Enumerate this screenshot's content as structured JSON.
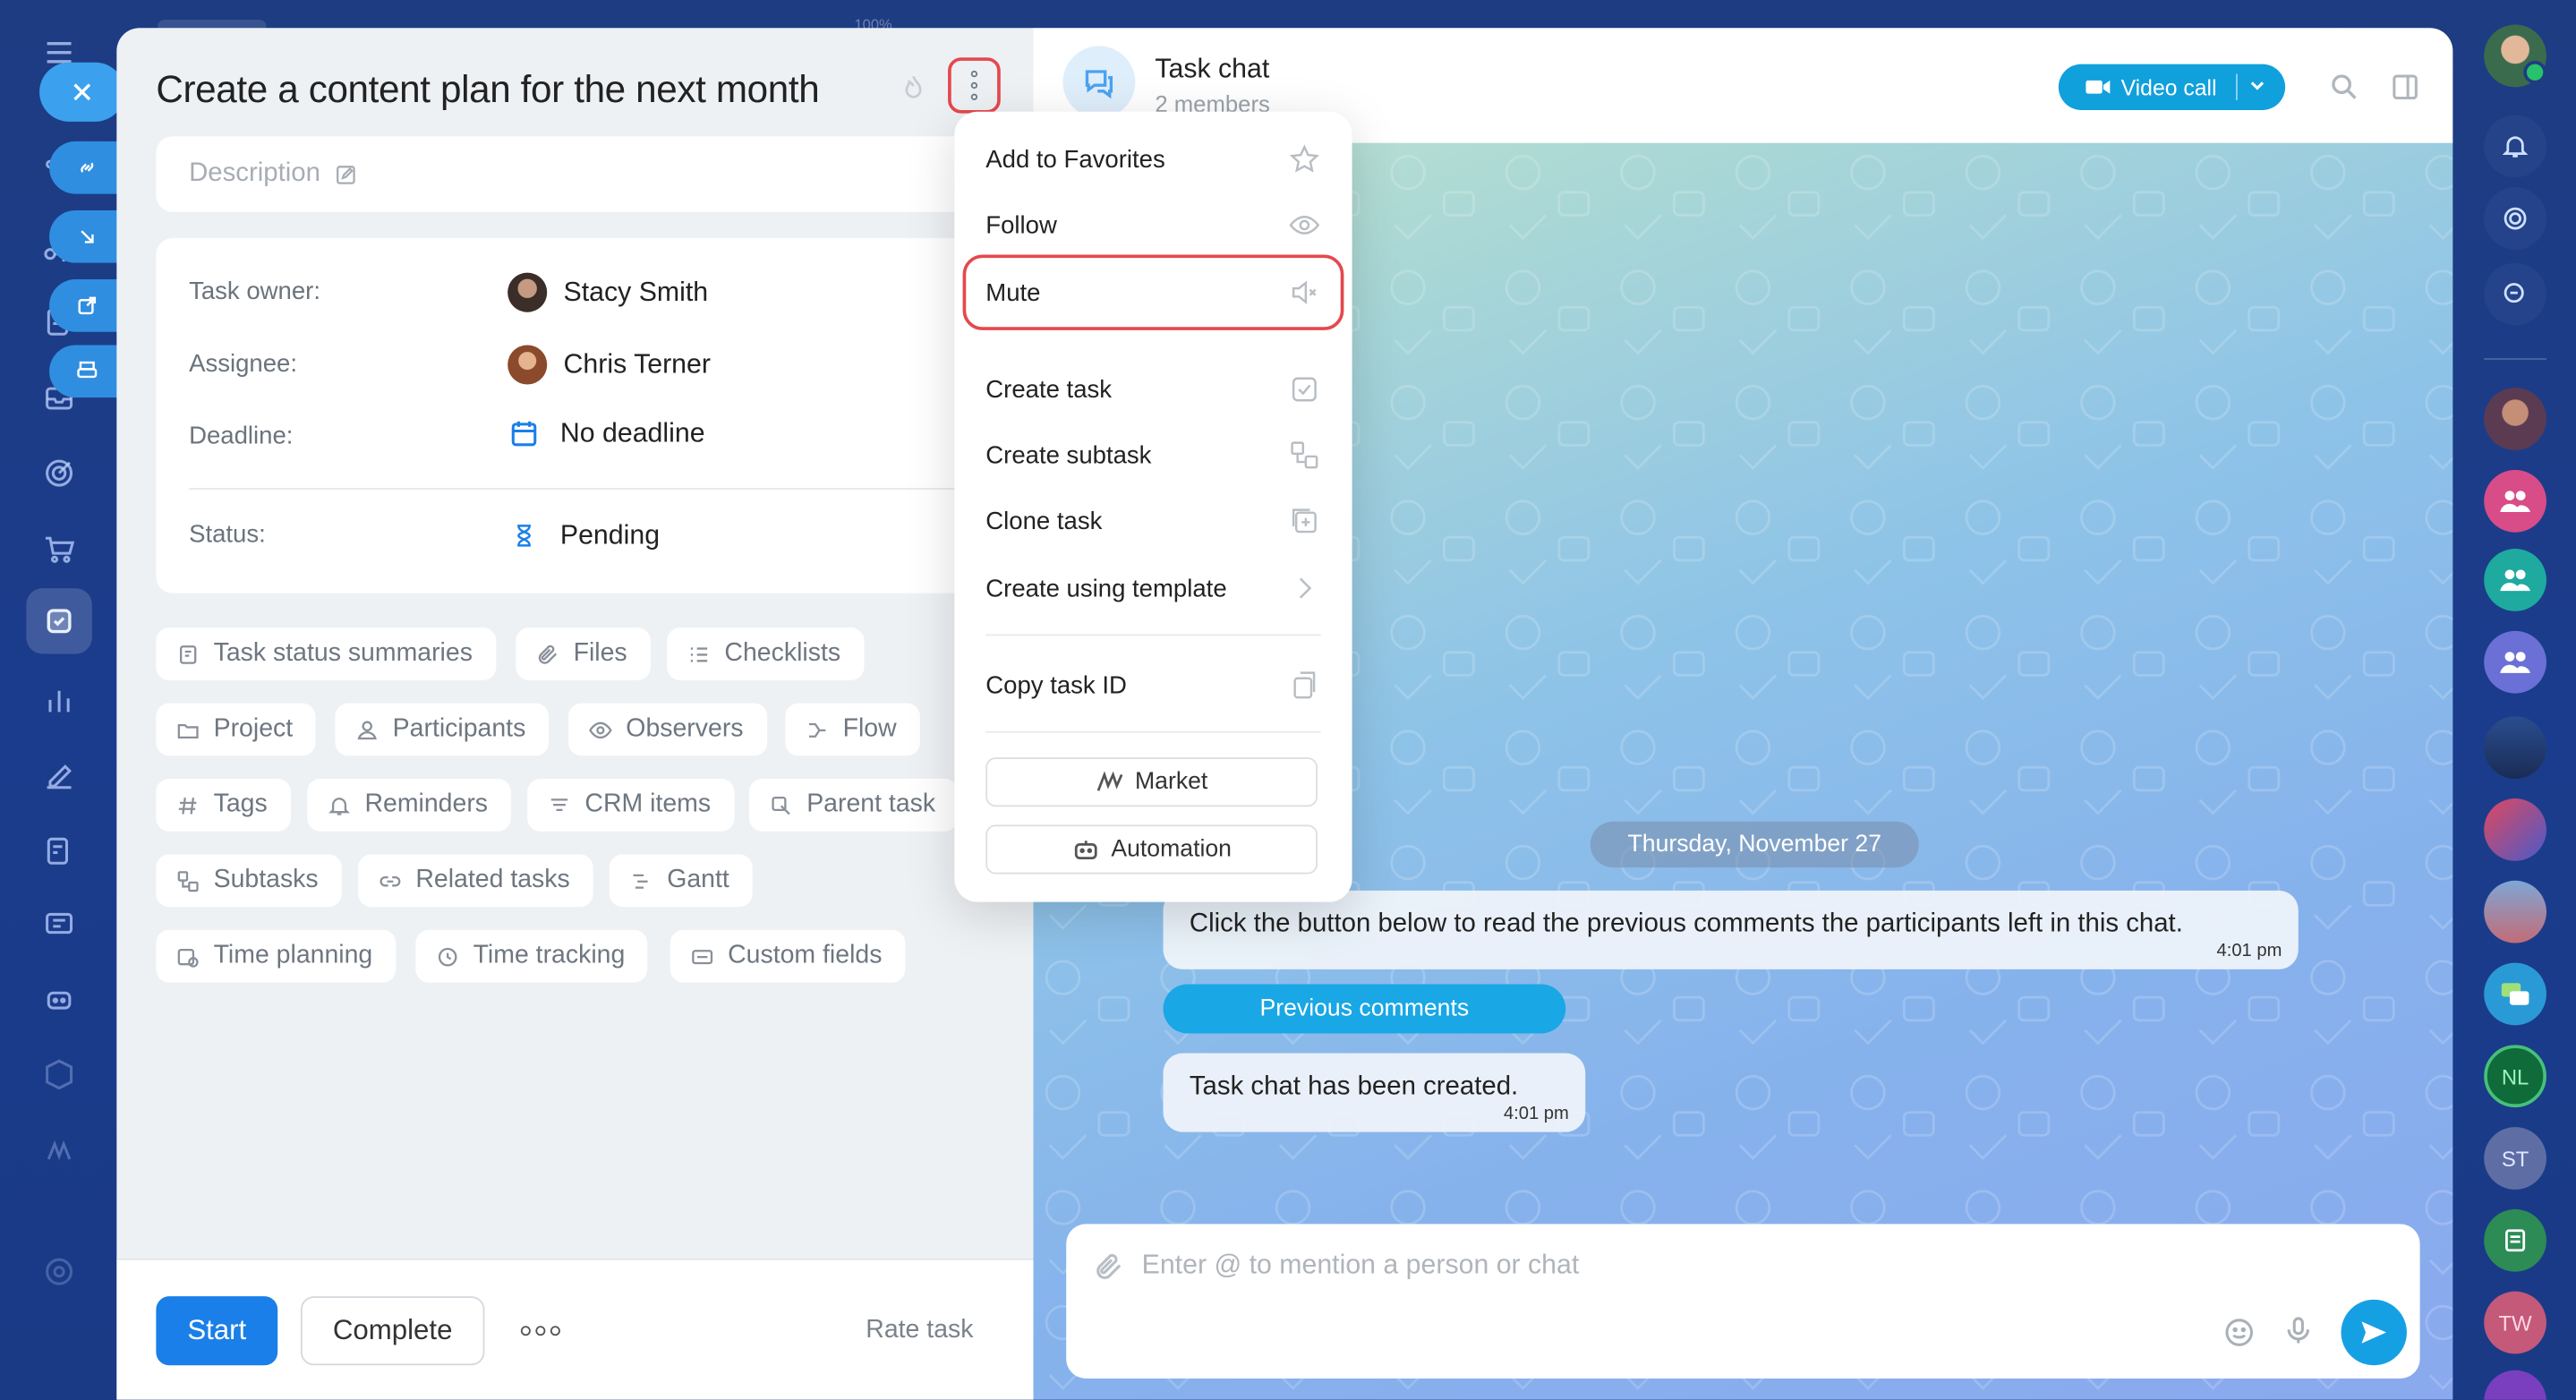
{
  "task": {
    "title": "Create a content plan for the next month",
    "description_placeholder": "Description",
    "fields": {
      "owner_label": "Task owner:",
      "owner_value": "Stacy Smith",
      "assignee_label": "Assignee:",
      "assignee_value": "Chris Terner",
      "deadline_label": "Deadline:",
      "deadline_value": "No deadline",
      "status_label": "Status:",
      "status_value": "Pending"
    },
    "chips": [
      {
        "label": "Task status summaries",
        "icon": "summary-icon"
      },
      {
        "label": "Files",
        "icon": "paperclip-icon"
      },
      {
        "label": "Checklists",
        "icon": "checklist-icon"
      },
      {
        "label": "Project",
        "icon": "folder-icon"
      },
      {
        "label": "Participants",
        "icon": "person-icon"
      },
      {
        "label": "Observers",
        "icon": "eye-icon"
      },
      {
        "label": "Flow",
        "icon": "flow-icon"
      },
      {
        "label": "Tags",
        "icon": "hash-icon"
      },
      {
        "label": "Reminders",
        "icon": "bell-icon"
      },
      {
        "label": "CRM items",
        "icon": "crm-icon"
      },
      {
        "label": "Parent task",
        "icon": "parent-task-icon"
      },
      {
        "label": "Subtasks",
        "icon": "subtasks-icon"
      },
      {
        "label": "Related tasks",
        "icon": "link-icon"
      },
      {
        "label": "Gantt",
        "icon": "gantt-icon"
      },
      {
        "label": "Time planning",
        "icon": "calendar-clock-icon"
      },
      {
        "label": "Time tracking",
        "icon": "clock-icon"
      },
      {
        "label": "Custom fields",
        "icon": "fields-icon"
      }
    ],
    "actions": {
      "start": "Start",
      "complete": "Complete",
      "rate": "Rate task"
    }
  },
  "menu": {
    "items": [
      {
        "label": "Add to Favorites",
        "icon": "star-icon"
      },
      {
        "label": "Follow",
        "icon": "eye-icon"
      },
      {
        "label": "Mute",
        "icon": "speaker-mute-icon"
      },
      {
        "label": "Create task",
        "icon": "checkbox-icon"
      },
      {
        "label": "Create subtask",
        "icon": "subtask-icon"
      },
      {
        "label": "Clone task",
        "icon": "clone-icon"
      },
      {
        "label": "Create using template",
        "icon": "chevron-right-icon"
      },
      {
        "label": "Copy task ID",
        "icon": "copy-icon"
      }
    ],
    "market": "Market",
    "automation": "Automation"
  },
  "chat": {
    "title": "Task chat",
    "subtitle": "2 members",
    "video_call": "Video call",
    "date": "Thursday, November 27",
    "messages": [
      {
        "text": "Click the button below to read the previous comments the participants left in this chat.",
        "time": "4:01 pm"
      },
      {
        "text": "Task chat has been created.",
        "time": "4:01 pm"
      }
    ],
    "previous_comments": "Previous comments",
    "input_placeholder": "Enter @ to mention a person or chat"
  },
  "right_sidebar": {
    "initials": [
      "NL",
      "ST",
      "TW"
    ]
  },
  "header_ghost": {
    "zoom": "100%"
  },
  "colors": {
    "accent": "#1a7fe8",
    "highlight_ring": "#e5484d",
    "chat_accent": "#16a0e4",
    "sidebar_bg": "#1e3c82"
  }
}
